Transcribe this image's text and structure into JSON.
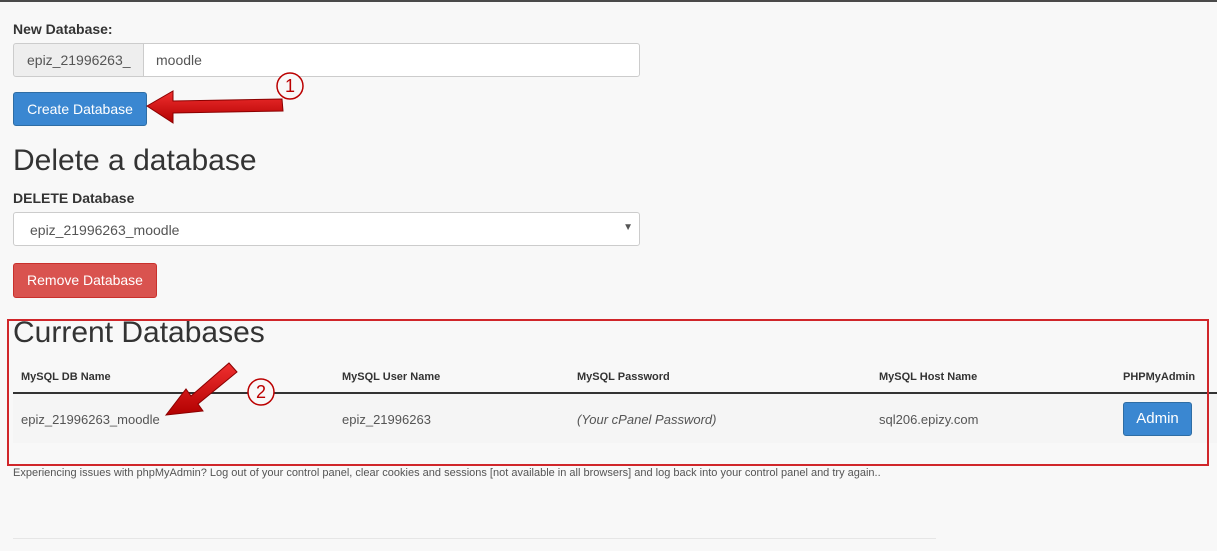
{
  "new_database": {
    "label": "New Database:",
    "prefix": "epiz_21996263_",
    "input_value": "moodle",
    "create_button": "Create Database"
  },
  "delete_database": {
    "heading": "Delete a database",
    "label": "DELETE Database",
    "selected": "epiz_21996263_moodle",
    "remove_button": "Remove Database"
  },
  "current_databases": {
    "heading": "Current Databases",
    "columns": [
      "MySQL DB Name",
      "MySQL User Name",
      "MySQL Password",
      "MySQL Host Name",
      "PHPMyAdmin"
    ],
    "rows": [
      {
        "db_name": "epiz_21996263_moodle",
        "user_name": "epiz_21996263",
        "password": "(Your cPanel Password)",
        "host": "sql206.epizy.com",
        "admin_button": "Admin"
      }
    ]
  },
  "note": "Experiencing issues with phpMyAdmin? Log out of your control panel, clear cookies and sessions [not available in all browsers] and log back into your control panel and try again..",
  "annotations": {
    "marker_1": "1",
    "marker_2": "2"
  },
  "colors": {
    "primary": "#3a87d1",
    "danger": "#d9534f",
    "annotation_red": "#d0262a"
  }
}
